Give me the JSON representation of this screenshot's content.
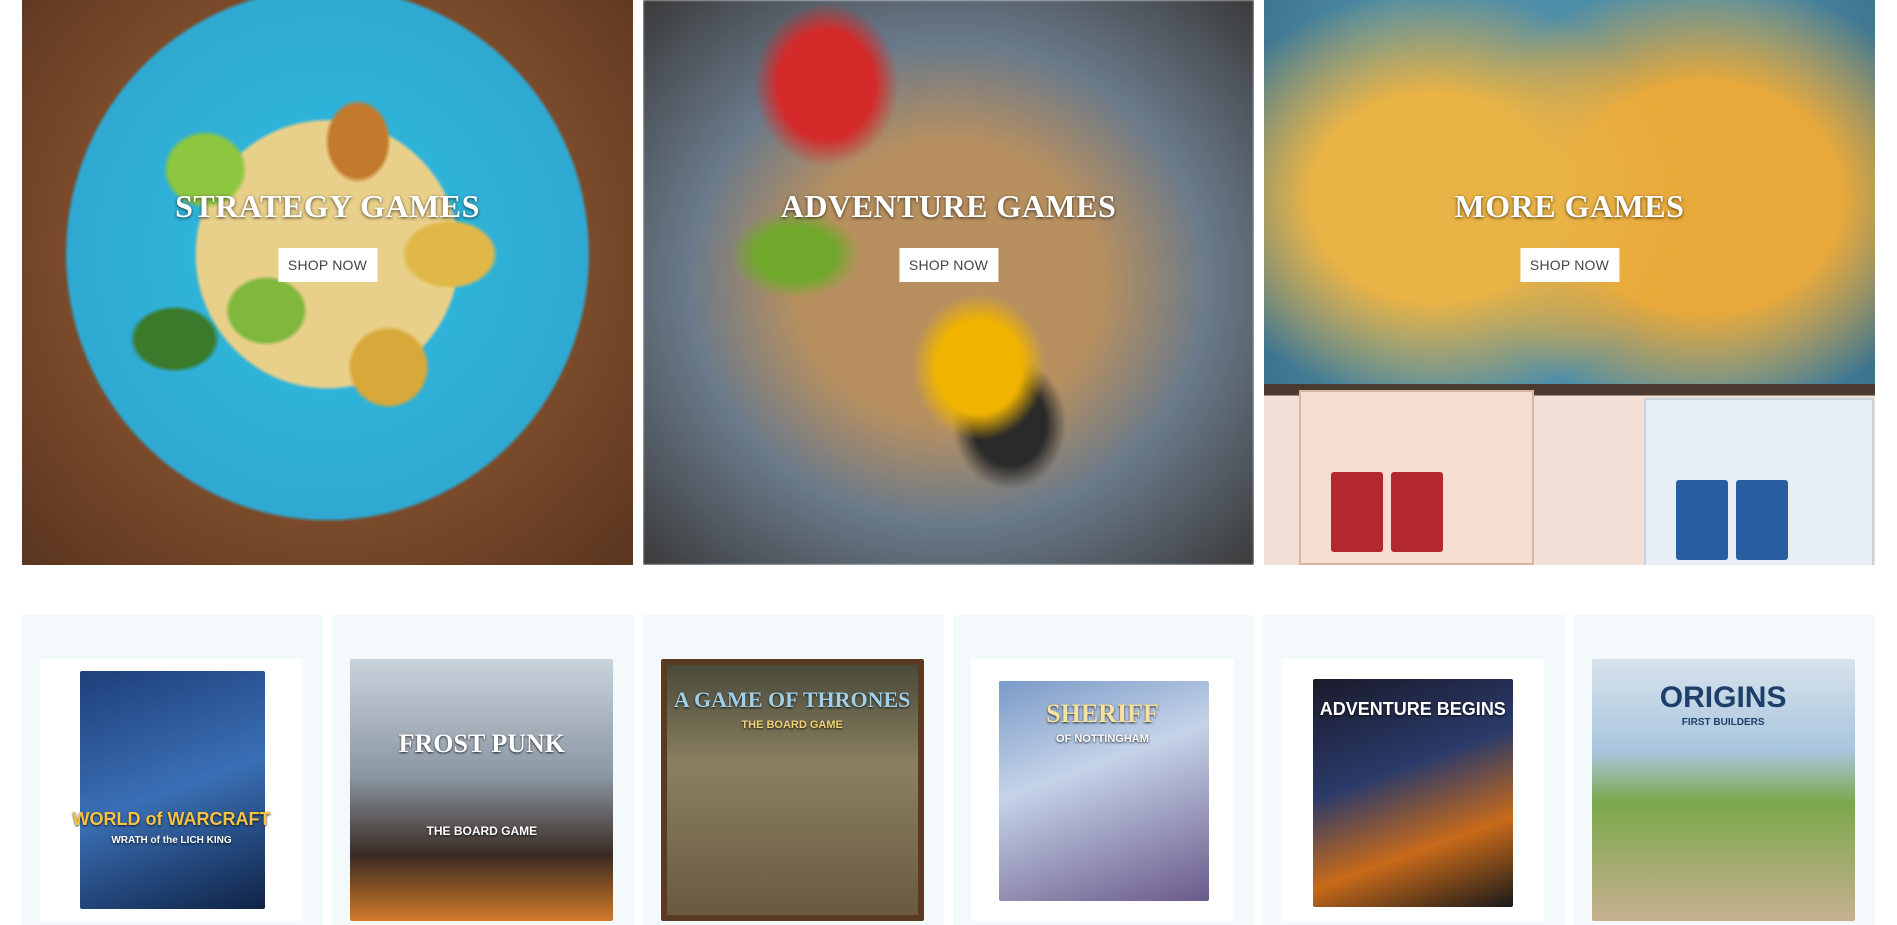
{
  "banners": [
    {
      "title": "STRATEGY GAMES",
      "button": "SHOP NOW"
    },
    {
      "title": "ADVENTURE GAMES",
      "button": "SHOP NOW"
    },
    {
      "title": "MORE GAMES",
      "button": "SHOP NOW"
    }
  ],
  "products": [
    {
      "box_text": "WORLD of WARCRAFT",
      "box_sub": "WRATH of the LICH KING"
    },
    {
      "box_text": "FROST PUNK",
      "box_sub": "THE BOARD GAME"
    },
    {
      "box_text": "A GAME OF THRONES",
      "box_sub": "THE BOARD GAME"
    },
    {
      "box_text": "SHERIFF",
      "box_sub": "OF NOTTINGHAM"
    },
    {
      "box_text": "ADVENTURE BEGINS",
      "box_sub": ""
    },
    {
      "box_text": "ORIGINS",
      "box_sub": "FIRST BUILDERS"
    }
  ]
}
